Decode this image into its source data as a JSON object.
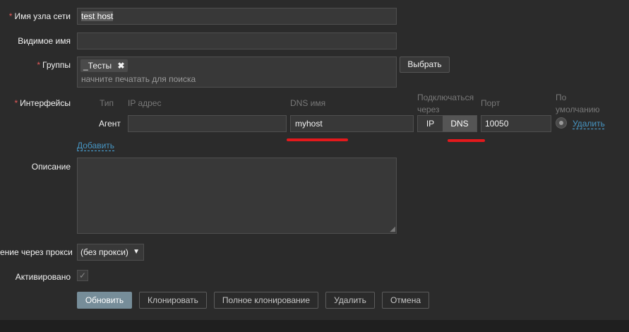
{
  "form": {
    "hostname": {
      "label": "Имя узла сети",
      "value": "test host"
    },
    "visible_name": {
      "label": "Видимое имя",
      "value": ""
    },
    "groups": {
      "label": "Группы",
      "tag": "_Тесты",
      "placeholder": "начните печатать для поиска",
      "select_button": "Выбрать"
    },
    "interfaces": {
      "label": "Интерфейсы",
      "headers": {
        "type": "Тип",
        "ip": "IP адрес",
        "dns": "DNS имя",
        "connect_line1": "Подключаться",
        "connect_line2": "через",
        "port": "Порт",
        "default_line1": "По",
        "default_line2": "умолчанию"
      },
      "row": {
        "type": "Агент",
        "ip": "",
        "dns": "myhost",
        "connect_ip": "IP",
        "connect_dns": "DNS",
        "port": "10050",
        "remove": "Удалить"
      },
      "add_link": "Добавить"
    },
    "description": {
      "label": "Описание",
      "value": ""
    },
    "proxy": {
      "label": "ение через прокси",
      "value": "(без прокси)"
    },
    "enabled": {
      "label": "Активировано",
      "checked": true
    }
  },
  "buttons": {
    "update": "Обновить",
    "clone": "Клонировать",
    "full_clone": "Полное клонирование",
    "delete": "Удалить",
    "cancel": "Отмена"
  },
  "colors": {
    "background": "#2b2b2b",
    "input_background": "#383838",
    "required": "#e45959",
    "link": "#4796c4",
    "primary_button": "#768d99",
    "annotation": "#e3191c"
  }
}
